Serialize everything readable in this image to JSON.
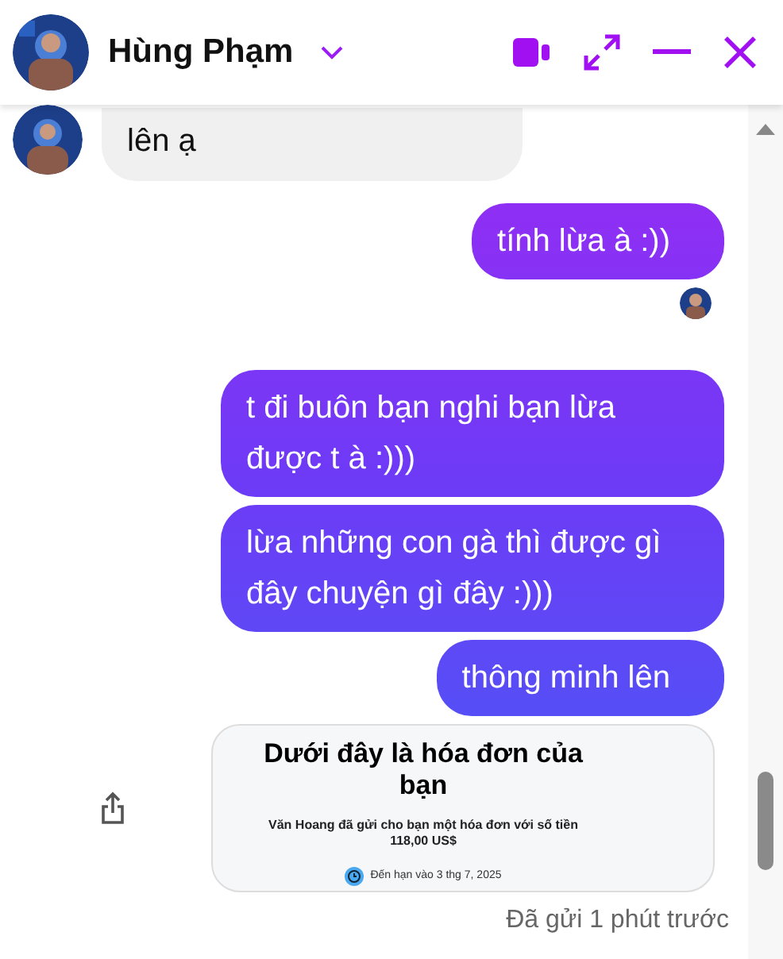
{
  "header": {
    "name": "Hùng Phạm"
  },
  "messages": [
    {
      "kind": "incoming",
      "text": "lên ạ"
    },
    {
      "kind": "outgoing",
      "text": "tính lừa à :))",
      "seen": true
    },
    {
      "kind": "outgoing",
      "text": "t đi buôn bạn nghi bạn lừa được t à :)))"
    },
    {
      "kind": "outgoing",
      "text": "lừa những con gà thì được gì đây chuyện gì đây :)))"
    },
    {
      "kind": "outgoing",
      "text": "thông minh lên"
    },
    {
      "kind": "invoice",
      "title": "Dưới đây là hóa đơn của bạn",
      "body": "Văn Hoang đã gửi cho bạn một hóa đơn với số tiền 118,00 US$",
      "due": "Đến hạn vào 3 thg 7, 2025"
    }
  ],
  "status": "Đã gửi 1 phút trước"
}
